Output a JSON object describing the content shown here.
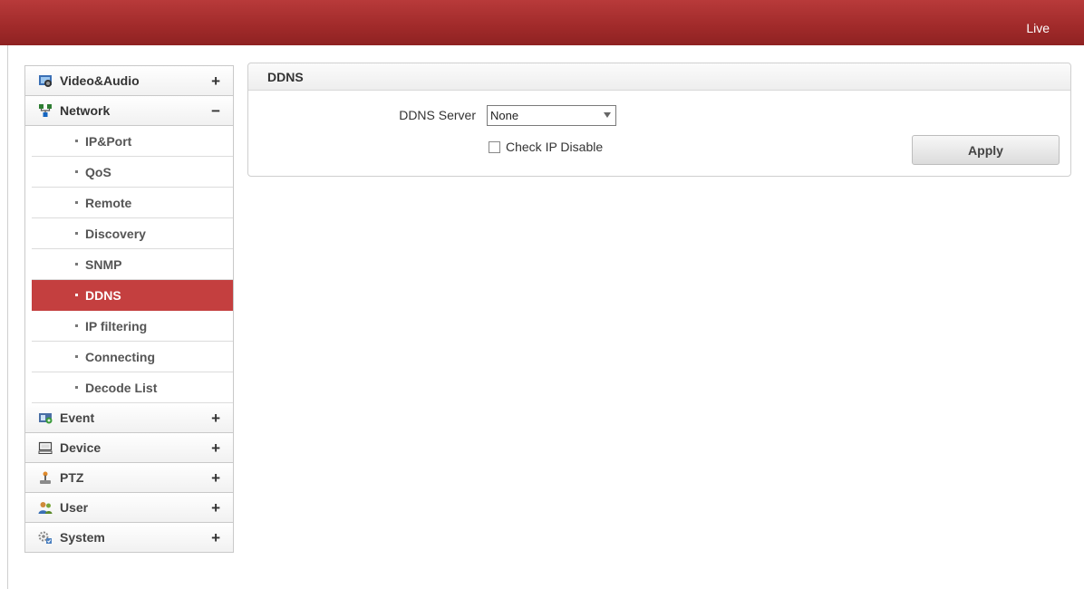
{
  "header": {
    "live_label": "Live"
  },
  "sidebar": {
    "video_audio": {
      "label": "Video&Audio",
      "toggle": "+",
      "icon": "video-audio-icon"
    },
    "network": {
      "label": "Network",
      "toggle": "−",
      "icon": "network-icon",
      "items": [
        "IP&Port",
        "QoS",
        "Remote",
        "Discovery",
        "SNMP",
        "DDNS",
        "IP filtering",
        "Connecting",
        "Decode List"
      ],
      "active": "DDNS"
    },
    "event": {
      "label": "Event",
      "toggle": "+",
      "icon": "event-icon"
    },
    "device": {
      "label": "Device",
      "toggle": "+",
      "icon": "device-icon"
    },
    "ptz": {
      "label": "PTZ",
      "toggle": "+",
      "icon": "ptz-icon"
    },
    "user": {
      "label": "User",
      "toggle": "+",
      "icon": "user-icon"
    },
    "system": {
      "label": "System",
      "toggle": "+",
      "icon": "system-icon"
    }
  },
  "panel": {
    "title": "DDNS",
    "ddns_server_label": "DDNS Server",
    "ddns_server_value": "None",
    "check_ip_disable_label": "Check IP Disable",
    "check_ip_disable_checked": false,
    "apply_label": "Apply"
  },
  "colors": {
    "topbar": "#a02a2a",
    "active_item": "#c43f3f"
  }
}
